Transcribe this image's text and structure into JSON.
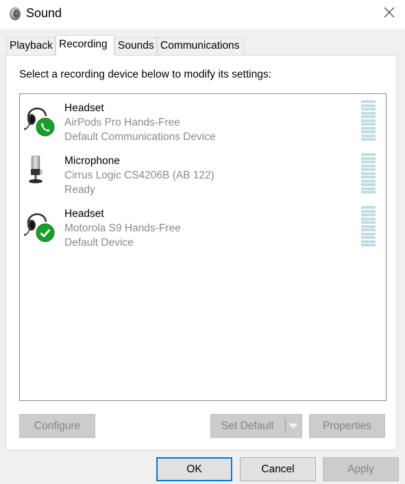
{
  "window": {
    "title": "Sound",
    "title_icon": "speaker-icon",
    "close_icon": "close-icon"
  },
  "tabs": [
    {
      "label": "Playback",
      "active": false
    },
    {
      "label": "Recording",
      "active": true
    },
    {
      "label": "Sounds",
      "active": false
    },
    {
      "label": "Communications",
      "active": false
    }
  ],
  "recording": {
    "instruction": "Select a recording device below to modify its settings:",
    "devices": [
      {
        "name": "Headset",
        "description": "AirPods Pro Hands-Free",
        "status": "Default Communications Device",
        "icon": "headset-icon",
        "badge": "phone-badge-icon",
        "level": 0,
        "meter_segments": 11
      },
      {
        "name": "Microphone",
        "description": "Cirrus Logic CS4206B (AB 122)",
        "status": "Ready",
        "icon": "microphone-icon",
        "badge": null,
        "level": 0,
        "meter_segments": 11
      },
      {
        "name": "Headset",
        "description": "Motorola S9 Hands-Free",
        "status": "Default Device",
        "icon": "headset-icon",
        "badge": "checkmark-badge-icon",
        "level": 0,
        "meter_segments": 11
      }
    ],
    "buttons": {
      "configure": "Configure",
      "set_default": "Set Default",
      "properties": "Properties"
    }
  },
  "footer": {
    "ok": "OK",
    "cancel": "Cancel",
    "apply": "Apply"
  },
  "colors": {
    "focus_accent": "#0078d7",
    "badge_green": "#1a9e2b",
    "meter_idle": "#c1dce4"
  }
}
